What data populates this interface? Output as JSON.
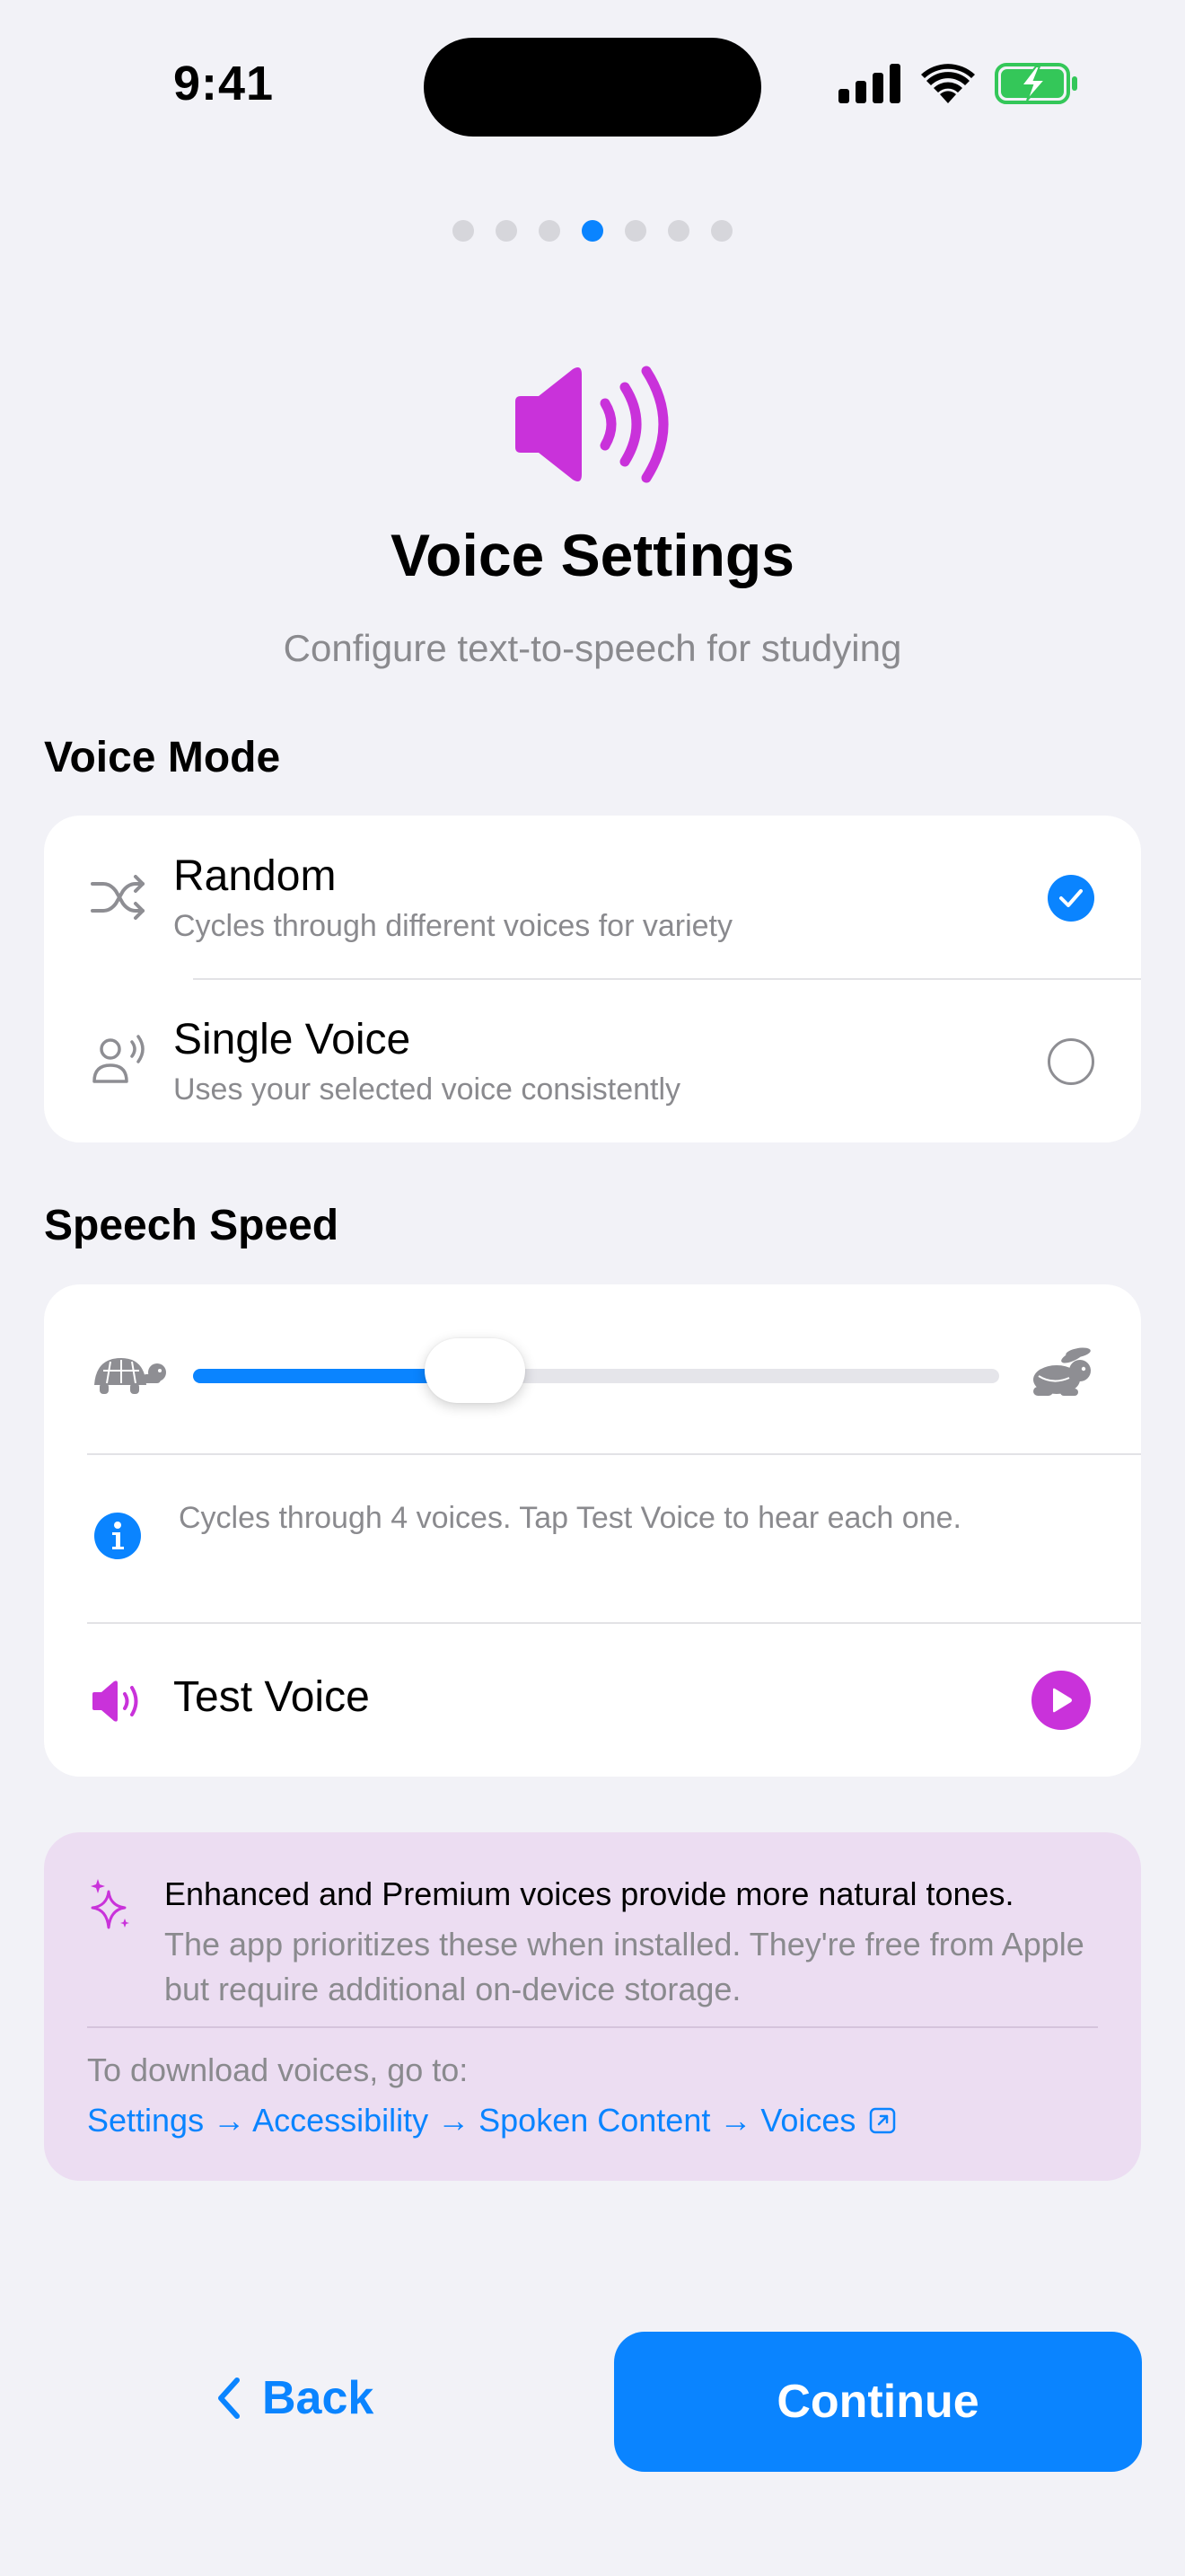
{
  "status_bar": {
    "time": "9:41"
  },
  "pager": {
    "total": 7,
    "active_index": 3
  },
  "header": {
    "title": "Voice Settings",
    "subtitle": "Configure text-to-speech for studying"
  },
  "voice_mode": {
    "section_title": "Voice Mode",
    "options": [
      {
        "title": "Random",
        "subtitle": "Cycles through different voices for variety",
        "selected": true
      },
      {
        "title": "Single Voice",
        "subtitle": "Uses your selected voice consistently",
        "selected": false
      }
    ]
  },
  "speech_speed": {
    "section_title": "Speech Speed",
    "slider_fraction": 0.35,
    "info": "Cycles through 4 voices. Tap Test Voice to hear each one.",
    "test_voice_label": "Test Voice"
  },
  "tip": {
    "title": "Enhanced and Premium voices provide more natural tones.",
    "body": "The app prioritizes these when installed. They're free from Apple but require additional on-device storage.",
    "download_label": "To download voices, go to:",
    "path": "Settings → Accessibility → Spoken Content → Voices"
  },
  "footer": {
    "back_label": "Back",
    "continue_label": "Continue"
  },
  "colors": {
    "accent": "#0A84FF",
    "speaker": "#C932DA",
    "tip_background": "#ECDDF2",
    "battery": "#34C759"
  }
}
